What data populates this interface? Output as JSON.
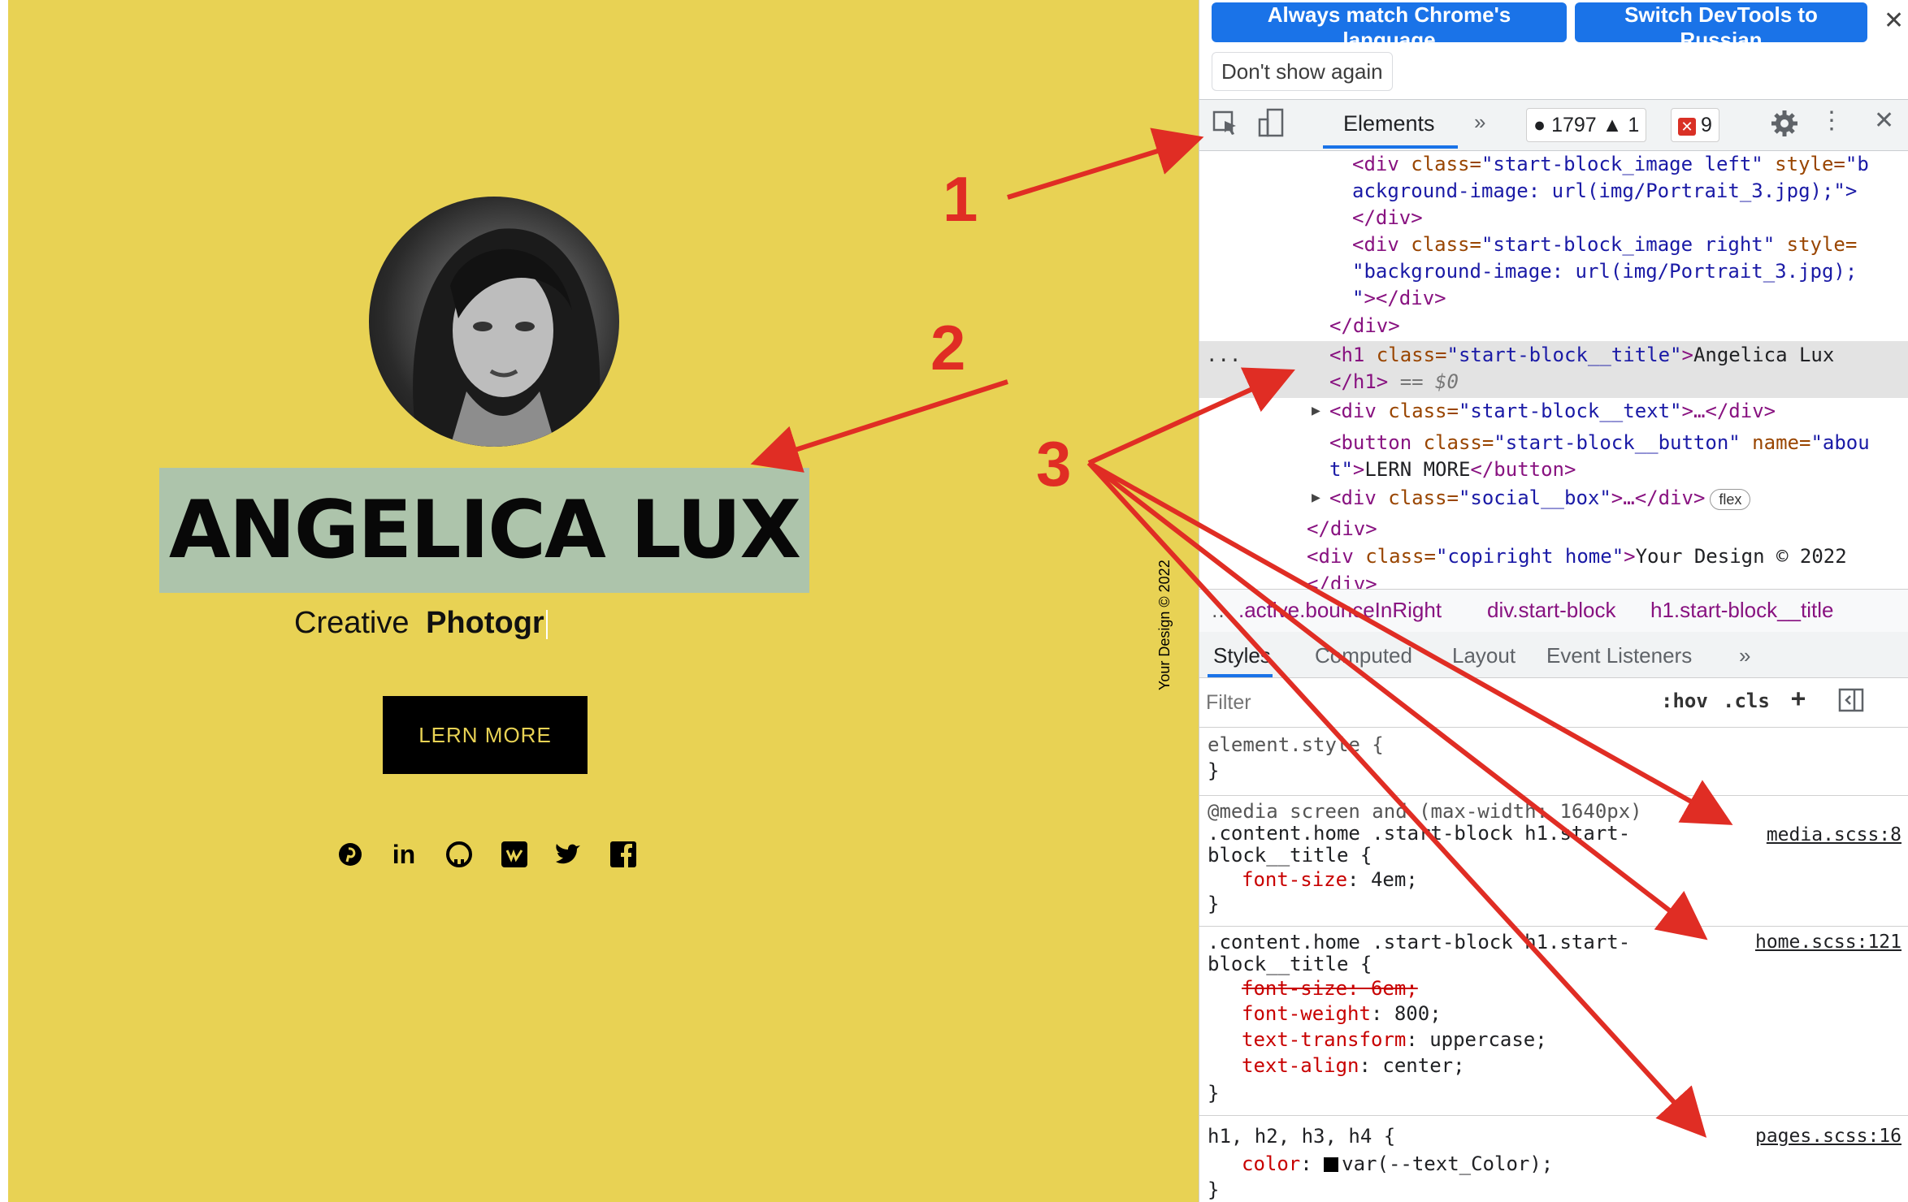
{
  "website": {
    "title": "Angelica Lux",
    "subtitle_plain": "Creative",
    "subtitle_bold": "Photogr",
    "button": "LERN MORE",
    "side_copyright": "Your Design © 2022",
    "social_icons": [
      "pinterest-icon",
      "linkedin-icon",
      "github-icon",
      "vk-icon",
      "twitter-icon",
      "facebook-icon"
    ]
  },
  "devtools": {
    "banner": {
      "always_match": "Always match Chrome's language",
      "switch_russian": "Switch DevTools to Russian",
      "dont_show": "Don't show again",
      "close": "✕"
    },
    "toolbar": {
      "elements_tab": "Elements",
      "more": "»",
      "warnings_count": "1797",
      "info_count": "1",
      "errors_count": "9"
    },
    "dom": {
      "l1_tag": "<div ",
      "l1_attr1": "class=",
      "l1_val1": "\"start-block_image left\"",
      "l1_attr2": " style=",
      "l1_val2": "\"b",
      "l2": "ackground-image: url(img/Portrait_3.jpg);\">",
      "l3": "</div>",
      "l4_tag": "<div ",
      "l4_attr1": "class=",
      "l4_val1": "\"start-block_image right\"",
      "l4_attr2": " style=",
      "l5": "\"background-image: url(img/Portrait_3.jpg);",
      "l6": "\"></div>",
      "l7": "</div>",
      "l8_dots": "...",
      "l8_tag": "<h1 ",
      "l8_attr": "class=",
      "l8_val": "\"start-block__title\"",
      "l8_text": "Angelica Lux",
      "l9": "</h1>",
      "l9_eq": " == $0",
      "l10_tag": "<div ",
      "l10_attr": "class=",
      "l10_val": "\"start-block__text\"",
      "l10_rest": ">…</div>",
      "l11_tag": "<button ",
      "l11_attr1": "class=",
      "l11_val1": "\"start-block__button\"",
      "l11_attr2": " name=",
      "l11_val2": "\"abou",
      "l12_val": "t\"",
      "l12_text": "LERN MORE",
      "l12_close": "</button>",
      "l13_tag": "<div ",
      "l13_attr": "class=",
      "l13_val": "\"social__box\"",
      "l13_rest": ">…</div>",
      "l13_badge": "flex",
      "l14": "</div>",
      "l15_tag": "<div ",
      "l15_attr": "class=",
      "l15_val": "\"copiright home\"",
      "l15_text": "Your Design © 2022",
      "l16": "</div>"
    },
    "breadcrumbs": [
      ".active.bounceInRight",
      "div.start-block",
      "h1.start-block__title"
    ],
    "subtabs": [
      "Styles",
      "Computed",
      "Layout",
      "Event Listeners",
      "»"
    ],
    "filter": {
      "placeholder": "Filter",
      "hov": ":hov",
      "cls": ".cls",
      "plus": "+"
    },
    "rules": {
      "element_style": "element.style {",
      "close": "}",
      "media_query": "@media screen and (max-width: 1640px)",
      "media_sel1": ".content.home .start-block h1.start-",
      "media_sel2": "block__title {",
      "media_prop": "font-size",
      "media_value": "4em;",
      "media_src": "media.scss:8",
      "home_sel1": ".content.home .start-block h1.start-",
      "home_sel2": "block__title {",
      "home_strike": "font-size: 6em;",
      "home_p1": "font-weight",
      "home_v1": "800;",
      "home_p2": "text-transform",
      "home_v2": "uppercase;",
      "home_p3": "text-align",
      "home_v3": "center;",
      "home_src": "home.scss:121",
      "h_sel": "h1, h2, h3, h4 {",
      "h_prop": "color",
      "h_value": "var(--text_Color);",
      "h_src": "pages.scss:16"
    }
  },
  "annotations": {
    "label_1": "1",
    "label_2": "2",
    "label_3": "3",
    "arrow_color": "#e02d24"
  }
}
